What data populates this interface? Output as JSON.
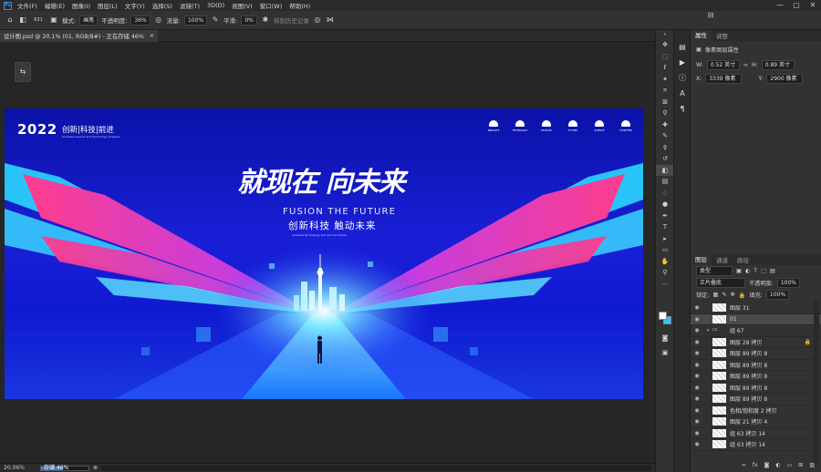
{
  "menubar": {
    "app_icon": "Ps",
    "items": [
      "文件(F)",
      "编辑(E)",
      "图像(I)",
      "图层(L)",
      "文字(Y)",
      "选择(S)",
      "滤镜(T)",
      "3D(D)",
      "视图(V)",
      "窗口(W)",
      "帮助(H)"
    ]
  },
  "window_controls": {
    "minimize": "—",
    "maximize": "▢",
    "close": "✕"
  },
  "options": {
    "brush_size": "631",
    "mode_label": "模式:",
    "mode_value": "画笔",
    "opacity_label": "不透明度:",
    "opacity_value": "36%",
    "flow_label": "流量:",
    "flow_value": "100%",
    "smooth_label": "平滑:",
    "smooth_value": "0%",
    "erase_history": "抹到历史记录"
  },
  "document_tab": {
    "title": "设计图.psd @ 20.1% (01, RGB/8#) - 正在存储 46%",
    "close": "×"
  },
  "artboard": {
    "year": "2022",
    "slogan": "创新|科技|前进",
    "slogan_sub": "Innovate science and technology progress",
    "title_cn": "就现在 向未来",
    "title_en": "FUSION  THE  FUTURE",
    "title_cn2": "创新科技  触动未来",
    "title_tiny": "Innovate technology and win win future",
    "icon_labels": [
      "INNOVATE",
      "TECHNOLOGY",
      "DEVELOP",
      "FUTURE",
      "SCIENCE",
      "TOGETHER"
    ]
  },
  "status": {
    "zoom": "20.06%",
    "progress_label": "存储",
    "progress_value": "46%",
    "progress_fraction": 0.46
  },
  "properties_panel": {
    "tabs": [
      "属性",
      "调整"
    ],
    "layer_type": "像素图层属性",
    "w_label": "W:",
    "w_value": "0.52 英寸",
    "h_label": "H:",
    "h_value": "0.89 英寸",
    "x_label": "X:",
    "x_value": "3339 像素",
    "y_label": "Y:",
    "y_value": "2900 像素",
    "link": "∞"
  },
  "layers_panel": {
    "tabs": [
      "图层",
      "通道",
      "路径"
    ],
    "filter_label": "类型",
    "blend_mode": "正片叠底",
    "opacity_label": "不透明度:",
    "opacity_value": "100%",
    "lock_label": "锁定:",
    "fill_label": "填充:",
    "fill_value": "100%",
    "layers": [
      {
        "name": "图层 31",
        "selected": false,
        "group": false,
        "locked": false
      },
      {
        "name": "01",
        "selected": true,
        "group": false,
        "locked": false
      },
      {
        "name": "组 67",
        "selected": false,
        "group": true,
        "locked": false
      },
      {
        "name": "图层 28 拷贝",
        "selected": false,
        "group": false,
        "locked": true
      },
      {
        "name": "图层 89 拷贝 8",
        "selected": false,
        "group": false,
        "locked": false
      },
      {
        "name": "图层 89 拷贝 8",
        "selected": false,
        "group": false,
        "locked": false
      },
      {
        "name": "图层 89 拷贝 8",
        "selected": false,
        "group": false,
        "locked": false
      },
      {
        "name": "图层 89 拷贝 8",
        "selected": false,
        "group": false,
        "locked": false
      },
      {
        "name": "图层 89 拷贝 8",
        "selected": false,
        "group": false,
        "locked": false
      },
      {
        "name": "色相/饱和度 2 拷贝",
        "selected": false,
        "group": false,
        "locked": false
      },
      {
        "name": "图层 21 拷贝 4",
        "selected": false,
        "group": false,
        "locked": false
      },
      {
        "name": "组 63 拷贝 14",
        "selected": false,
        "group": false,
        "locked": false
      },
      {
        "name": "组 63 拷贝 14",
        "selected": false,
        "group": false,
        "locked": false
      }
    ]
  },
  "colors": {
    "accent": "#3a8dde",
    "pink": "#ff3d8b",
    "cyan": "#39d6ff",
    "deep_blue": "#0b12a8"
  }
}
